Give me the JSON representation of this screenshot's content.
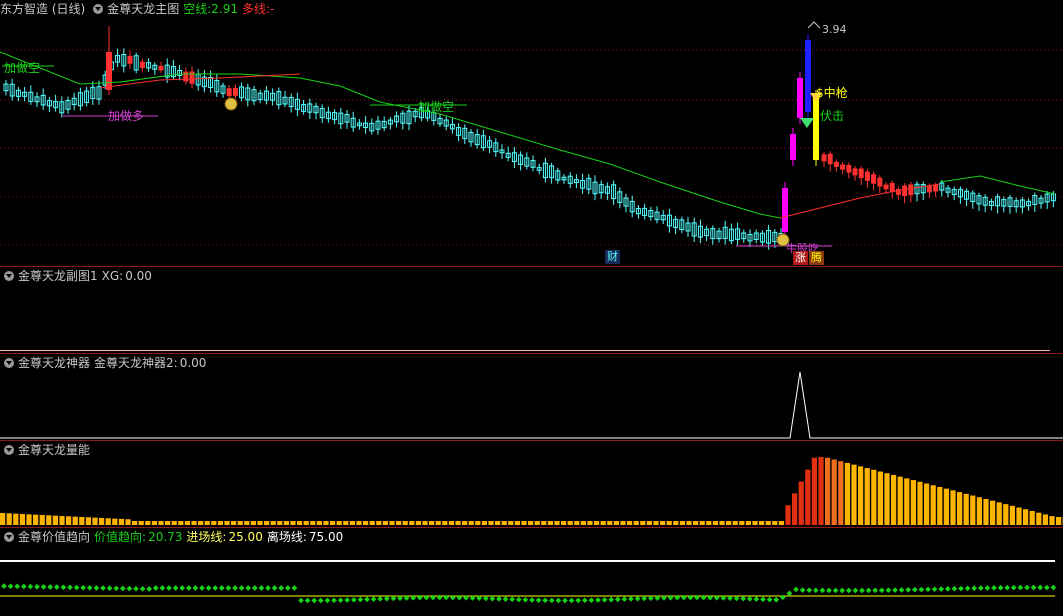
{
  "main_panel": {
    "title": "东方智造 (日线)",
    "indicator": "金尊天龙主图",
    "empty_label": "空线:",
    "empty_value": "2.91",
    "long_label": "多线:",
    "long_value": "-",
    "annotations": {
      "add_short_left": "加做空",
      "add_long": "加做多",
      "add_short_mid": "加做空",
      "peak_value": "3.94",
      "hit_gun": "$中枪",
      "ambush": "伏击",
      "bottom_label": "牛股吃",
      "badge_cai": "财",
      "badge_zhang": "涨",
      "badge_teng": "腾"
    }
  },
  "sub1": {
    "title": "金尊天龙副图1",
    "label": "XG:",
    "value": "0.00"
  },
  "sub2": {
    "title": "金尊天龙神器",
    "label": "金尊天龙神器2:",
    "value": "0.00"
  },
  "sub3": {
    "title": "金尊天龙量能"
  },
  "sub4": {
    "title": "金尊价值趋向",
    "trend_label": "价值趋向:",
    "trend_value": "20.73",
    "entry_label": "进场线:",
    "entry_value": "25.00",
    "exit_label": "离场线:",
    "exit_value": "75.00"
  },
  "colors": {
    "green": "#19d219",
    "red": "#ff3030",
    "cyan": "#54ffff",
    "magenta": "#ff00ff",
    "yellow": "#ffff00",
    "orange": "#ffb400",
    "white": "#ffffff",
    "title": "#c8c8c8"
  },
  "chart_data": {
    "type": "candlestick",
    "title": "东方智造 (日线)",
    "annotated_high": 3.94,
    "empty_line_last": 2.91,
    "sub_value_trend": 20.73,
    "entry_line": 25.0,
    "exit_line": 75.0
  }
}
